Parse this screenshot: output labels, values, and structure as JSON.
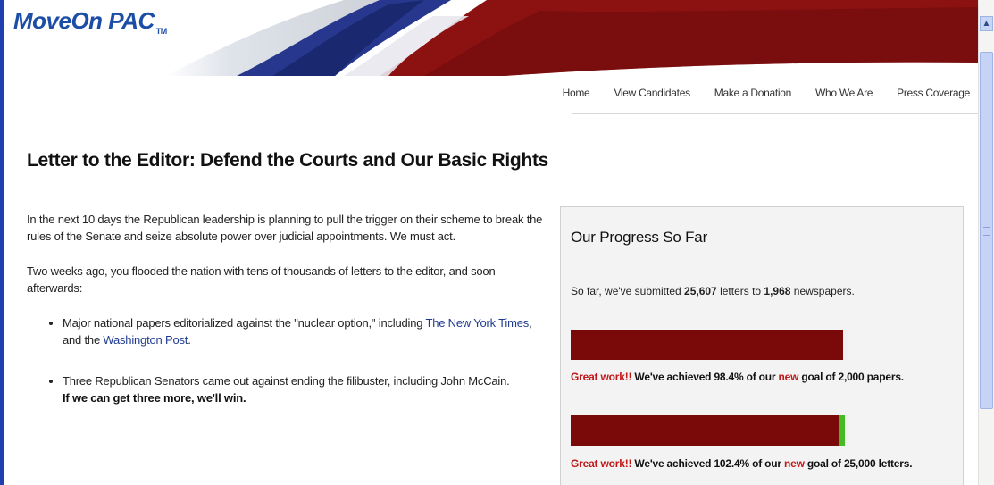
{
  "header": {
    "logo_text": "MoveOn PAC",
    "logo_tm": "TM"
  },
  "nav": {
    "items": [
      {
        "label": "Home"
      },
      {
        "label": "View Candidates"
      },
      {
        "label": "Make a Donation"
      },
      {
        "label": "Who We Are"
      },
      {
        "label": "Press Coverage"
      }
    ]
  },
  "main": {
    "title": "Letter to the Editor: Defend the Courts and Our Basic Rights",
    "para1": "In the next 10 days the Republican leadership is planning to pull the trigger on their scheme to break the rules of the Senate and seize absolute power over judicial appointments. We must act.",
    "para2": "Two weeks ago, you flooded the nation with tens of thousands of letters to the editor, and soon afterwards:",
    "bullet1_text": "Major national papers editorialized against the \"nuclear option,\" including ",
    "bullet1_link1": "The New York Times",
    "bullet1_mid": ", and the ",
    "bullet1_link2": "Washington Post",
    "bullet1_end": ".",
    "bullet2_text": "Three Republican Senators came out against ending the filibuster, including John McCain.",
    "bullet2_bold": "If we can get three more, we'll win."
  },
  "progress": {
    "title": "Our Progress So Far",
    "summary_pre": "So far, we've submitted ",
    "letters_count": "25,607",
    "summary_mid": " letters to ",
    "papers_count": "1,968",
    "summary_end": " newspapers.",
    "bars": [
      {
        "percent": 98.4,
        "great": "Great work!!",
        "pre": " We've achieved 98.4% of our ",
        "new": "new",
        "post": " goal of 2,000 papers."
      },
      {
        "percent": 102.4,
        "great": "Great work!!",
        "pre": " We've achieved 102.4% of our ",
        "new": "new",
        "post": " goal of 25,000 letters."
      }
    ]
  },
  "colors": {
    "bar_fill": "#7a0a0a",
    "bar_over": "#44bb22",
    "accent_red": "#c01818",
    "link_blue": "#1f3b8f"
  }
}
